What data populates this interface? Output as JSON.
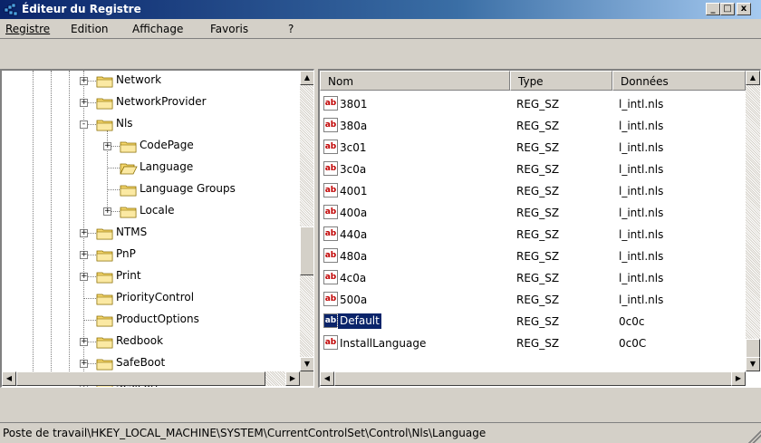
{
  "window": {
    "title": "Éditeur du Registre",
    "buttons": {
      "minimize": "_",
      "maximize": "□",
      "close": "x"
    }
  },
  "menu": [
    {
      "label": "Registre",
      "underline": "R"
    },
    {
      "label": "Edition",
      "underline": "E"
    },
    {
      "label": "Affichage",
      "underline": "f"
    },
    {
      "label": "Favoris",
      "underline": "v"
    },
    {
      "label": "?",
      "underline": "?"
    }
  ],
  "tree": {
    "items": [
      {
        "label": "Network",
        "level": 0,
        "expander": "+"
      },
      {
        "label": "NetworkProvider",
        "level": 0,
        "expander": "+"
      },
      {
        "label": "Nls",
        "level": 0,
        "expander": "-"
      },
      {
        "label": "CodePage",
        "level": 1,
        "expander": "+"
      },
      {
        "label": "Language",
        "level": 1,
        "expander": "",
        "open": true
      },
      {
        "label": "Language Groups",
        "level": 1,
        "expander": ""
      },
      {
        "label": "Locale",
        "level": 1,
        "expander": "+"
      },
      {
        "label": "NTMS",
        "level": 0,
        "expander": "+"
      },
      {
        "label": "PnP",
        "level": 0,
        "expander": "+"
      },
      {
        "label": "Print",
        "level": 0,
        "expander": "+"
      },
      {
        "label": "PriorityControl",
        "level": 0,
        "expander": ""
      },
      {
        "label": "ProductOptions",
        "level": 0,
        "expander": ""
      },
      {
        "label": "Redbook",
        "level": 0,
        "expander": "+"
      },
      {
        "label": "SafeBoot",
        "level": 0,
        "expander": "+"
      },
      {
        "label": "ScsiPort",
        "level": 0,
        "expander": "+"
      }
    ]
  },
  "list": {
    "columns": [
      "Nom",
      "Type",
      "Données"
    ],
    "rows": [
      {
        "name": "3801",
        "type": "REG_SZ",
        "data": "l_intl.nls"
      },
      {
        "name": "380a",
        "type": "REG_SZ",
        "data": "l_intl.nls"
      },
      {
        "name": "3c01",
        "type": "REG_SZ",
        "data": "l_intl.nls"
      },
      {
        "name": "3c0a",
        "type": "REG_SZ",
        "data": "l_intl.nls"
      },
      {
        "name": "4001",
        "type": "REG_SZ",
        "data": "l_intl.nls"
      },
      {
        "name": "400a",
        "type": "REG_SZ",
        "data": "l_intl.nls"
      },
      {
        "name": "440a",
        "type": "REG_SZ",
        "data": "l_intl.nls"
      },
      {
        "name": "480a",
        "type": "REG_SZ",
        "data": "l_intl.nls"
      },
      {
        "name": "4c0a",
        "type": "REG_SZ",
        "data": "l_intl.nls"
      },
      {
        "name": "500a",
        "type": "REG_SZ",
        "data": "l_intl.nls"
      },
      {
        "name": "Default",
        "type": "REG_SZ",
        "data": "0c0c",
        "selected": true
      },
      {
        "name": "InstallLanguage",
        "type": "REG_SZ",
        "data": "0c0C"
      }
    ],
    "value_icon_text": "ab"
  },
  "statusbar": {
    "path": "Poste de travail\\HKEY_LOCAL_MACHINE\\SYSTEM\\CurrentControlSet\\Control\\Nls\\Language"
  },
  "colors": {
    "titlebar_start": "#0a246a",
    "titlebar_end": "#a6caf0",
    "selection": "#0a246a",
    "face": "#d4d0c8",
    "folder": "#f5d76e"
  }
}
